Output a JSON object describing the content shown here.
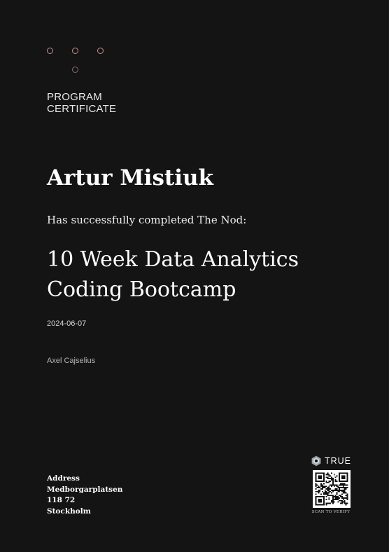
{
  "certificate": {
    "label_line1": "PROGRAM",
    "label_line2": "CERTIFICATE",
    "recipient_name": "Artur Mistiuk",
    "completion_text": "Has successfully completed The Nod:",
    "course_line1": "10 Week Data Analytics",
    "course_line2": "Coding Bootcamp",
    "date": "2024-06-07",
    "signer": "Axel Cajselius"
  },
  "address": {
    "heading": "Address",
    "street": "Medborgarplatsen",
    "postal_code": "118 72",
    "city": "Stockholm"
  },
  "verification": {
    "brand": "TRUE",
    "brand_icon": "hexagon-logo-icon",
    "qr_icon": "qr-code-icon",
    "scan_label": "SCAN TO VERIFY"
  },
  "colors": {
    "background": "#141414",
    "accent_dots": "#c8908f",
    "text": "#ffffff"
  }
}
